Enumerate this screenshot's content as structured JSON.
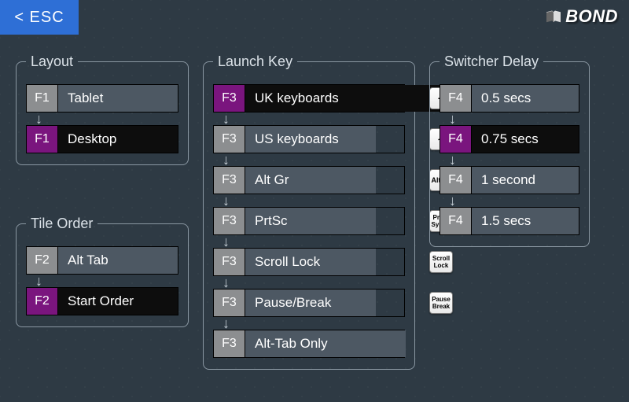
{
  "esc_label": "< ESC",
  "logo_text": "BOND",
  "groups": {
    "layout": {
      "title": "Layout",
      "fkey": "F1",
      "items": [
        {
          "label": "Tablet",
          "selected": false
        },
        {
          "label": "Desktop",
          "selected": true
        }
      ]
    },
    "tile_order": {
      "title": "Tile Order",
      "fkey": "F2",
      "items": [
        {
          "label": "Alt Tab",
          "selected": false
        },
        {
          "label": "Start Order",
          "selected": true
        }
      ]
    },
    "launch_key": {
      "title": "Launch Key",
      "fkey": "F3",
      "items": [
        {
          "label": "UK keyboards",
          "selected": true,
          "keycap": {
            "lines": [
              "¬"
            ],
            "big": true
          }
        },
        {
          "label": "US keyboards",
          "selected": false,
          "keycap": {
            "lines": [
              "~"
            ],
            "big": true
          }
        },
        {
          "label": "Alt Gr",
          "selected": false,
          "keycap": {
            "lines": [
              "Alt Gr"
            ]
          }
        },
        {
          "label": "PrtSc",
          "selected": false,
          "keycap": {
            "lines": [
              "PrtSc",
              "SysRq"
            ]
          }
        },
        {
          "label": "Scroll Lock",
          "selected": false,
          "keycap": {
            "lines": [
              "Scroll",
              "Lock"
            ]
          }
        },
        {
          "label": "Pause/Break",
          "selected": false,
          "keycap": {
            "lines": [
              "Pause",
              "Break"
            ]
          }
        },
        {
          "label": "Alt-Tab Only",
          "selected": false,
          "keycap": null
        }
      ]
    },
    "switcher_delay": {
      "title": "Switcher Delay",
      "fkey": "F4",
      "items": [
        {
          "label": "0.5 secs",
          "selected": false
        },
        {
          "label": "0.75 secs",
          "selected": true
        },
        {
          "label": "1 second",
          "selected": false
        },
        {
          "label": "1.5 secs",
          "selected": false
        }
      ]
    }
  }
}
